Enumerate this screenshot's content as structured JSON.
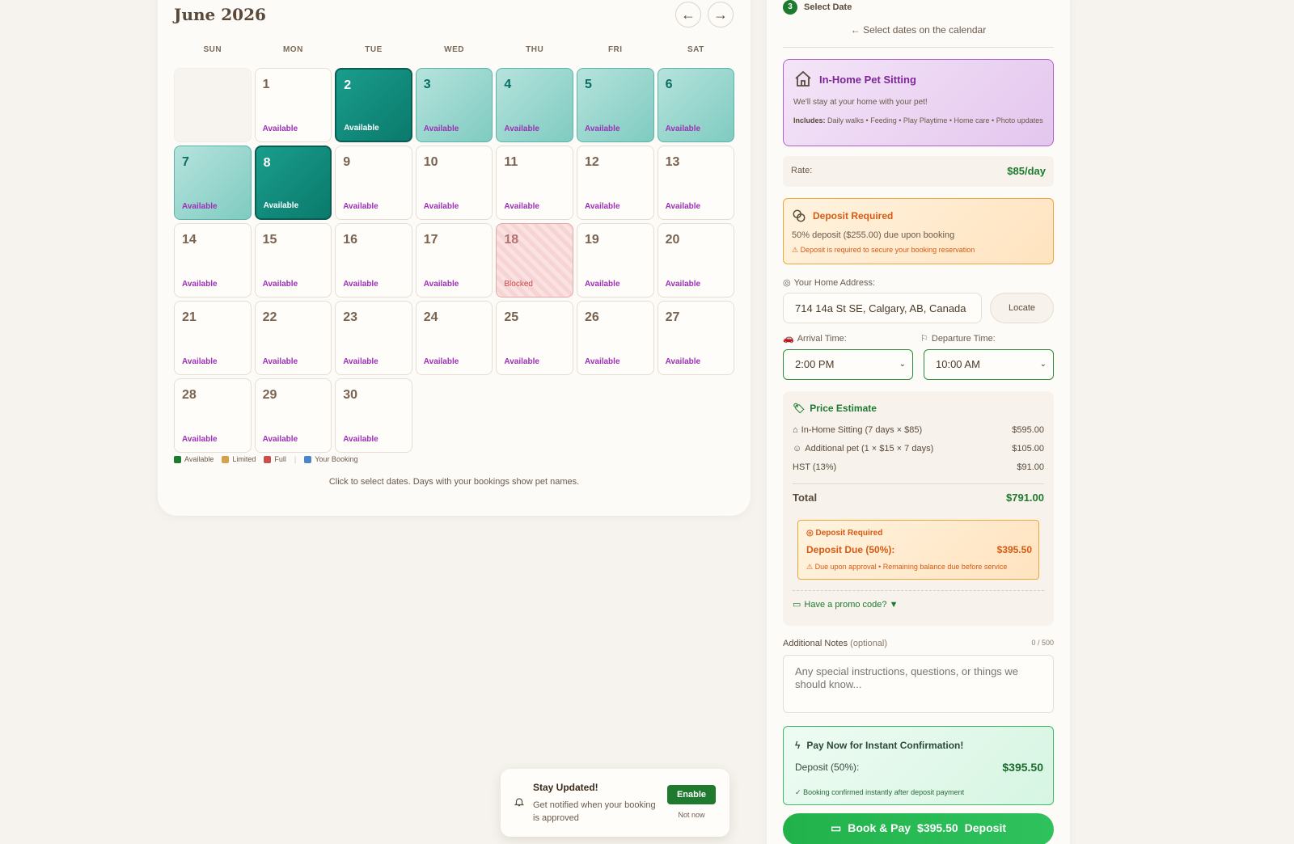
{
  "calendar": {
    "title": "June 2026",
    "prev_label": "←",
    "next_label": "→",
    "weekdays": [
      "SUN",
      "MON",
      "TUE",
      "WED",
      "THU",
      "FRI",
      "SAT"
    ],
    "days": [
      {
        "num": "",
        "status": "",
        "kind": "empty"
      },
      {
        "num": "1",
        "status": "Available",
        "kind": "normal"
      },
      {
        "num": "2",
        "status": "Available",
        "kind": "end"
      },
      {
        "num": "3",
        "status": "Available",
        "kind": "range"
      },
      {
        "num": "4",
        "status": "Available",
        "kind": "range"
      },
      {
        "num": "5",
        "status": "Available",
        "kind": "range"
      },
      {
        "num": "6",
        "status": "Available",
        "kind": "range"
      },
      {
        "num": "7",
        "status": "Available",
        "kind": "range"
      },
      {
        "num": "8",
        "status": "Available",
        "kind": "end"
      },
      {
        "num": "9",
        "status": "Available",
        "kind": "normal"
      },
      {
        "num": "10",
        "status": "Available",
        "kind": "normal"
      },
      {
        "num": "11",
        "status": "Available",
        "kind": "normal"
      },
      {
        "num": "12",
        "status": "Available",
        "kind": "normal"
      },
      {
        "num": "13",
        "status": "Available",
        "kind": "normal"
      },
      {
        "num": "14",
        "status": "Available",
        "kind": "normal"
      },
      {
        "num": "15",
        "status": "Available",
        "kind": "normal"
      },
      {
        "num": "16",
        "status": "Available",
        "kind": "normal"
      },
      {
        "num": "17",
        "status": "Available",
        "kind": "normal"
      },
      {
        "num": "18",
        "status": "Blocked",
        "kind": "blocked"
      },
      {
        "num": "19",
        "status": "Available",
        "kind": "normal"
      },
      {
        "num": "20",
        "status": "Available",
        "kind": "normal"
      },
      {
        "num": "21",
        "status": "Available",
        "kind": "normal"
      },
      {
        "num": "22",
        "status": "Available",
        "kind": "normal"
      },
      {
        "num": "23",
        "status": "Available",
        "kind": "normal"
      },
      {
        "num": "24",
        "status": "Available",
        "kind": "normal"
      },
      {
        "num": "25",
        "status": "Available",
        "kind": "normal"
      },
      {
        "num": "26",
        "status": "Available",
        "kind": "normal"
      },
      {
        "num": "27",
        "status": "Available",
        "kind": "normal"
      },
      {
        "num": "28",
        "status": "Available",
        "kind": "normal"
      },
      {
        "num": "29",
        "status": "Available",
        "kind": "normal"
      },
      {
        "num": "30",
        "status": "Available",
        "kind": "normal"
      }
    ],
    "legend": [
      {
        "label": "Available",
        "color": "#1d7a2e"
      },
      {
        "label": "Limited",
        "color": "#d4a24a"
      },
      {
        "label": "Full",
        "color": "#c9504a"
      },
      {
        "label": "Your Booking",
        "color": "#4a86c9"
      }
    ],
    "hint": "Click to select dates. Days with your bookings show pet names."
  },
  "panel": {
    "step_num": "3",
    "step_label": "Select Date",
    "select_hint": "Select dates on the calendar",
    "service": {
      "title": "In-Home Pet Sitting",
      "desc": "We'll stay at your home with your pet!",
      "includes_label": "Includes:",
      "includes": "Daily walks • Feeding • Play Playtime • Home care • Photo updates"
    },
    "rate_label": "Rate:",
    "rate_value": "$85/day",
    "deposit": {
      "title": "Deposit Required",
      "desc": "50% deposit ($255.00) due upon booking",
      "warning": "Deposit is required to secure your booking reservation"
    },
    "address_label": "Your Home Address:",
    "address_value": "714 14a St SE, Calgary, AB, Canada",
    "locate_label": "Locate",
    "arrival_label": "Arrival Time:",
    "arrival_value": "2:00 PM",
    "departure_label": "Departure Time:",
    "departure_value": "10:00 AM",
    "price": {
      "title": "Price Estimate",
      "rows": [
        {
          "name": "In-Home Sitting (7 days × $85)",
          "value": "$595.00"
        },
        {
          "name": "Additional pet (1 × $15 × 7 days)",
          "value": "$105.00"
        },
        {
          "name": "HST (13%)",
          "value": "$91.00"
        }
      ],
      "total_label": "Total",
      "total_value": "$791.00",
      "deposit_title": "Deposit Required",
      "deposit_due_label": "Deposit Due (50%):",
      "deposit_due_value": "$395.50",
      "deposit_sub": "Due upon approval • Remaining balance due before service",
      "promo": "Have a promo code? ▼"
    },
    "notes_label": "Additional Notes",
    "notes_optional": "(optional)",
    "notes_count": "0 / 500",
    "notes_placeholder": "Any special instructions, questions, or things we should know...",
    "pay": {
      "title": "Pay Now for Instant Confirmation!",
      "deposit_label": "Deposit (50%):",
      "deposit_value": "$395.50",
      "sub": "Booking confirmed instantly after deposit payment"
    },
    "book_label": "Book & Pay",
    "book_amount": "$395.50",
    "book_suffix": "Deposit"
  },
  "toast": {
    "title": "Stay Updated!",
    "desc": "Get notified when your booking is approved",
    "enable": "Enable",
    "dismiss": "Not now"
  }
}
